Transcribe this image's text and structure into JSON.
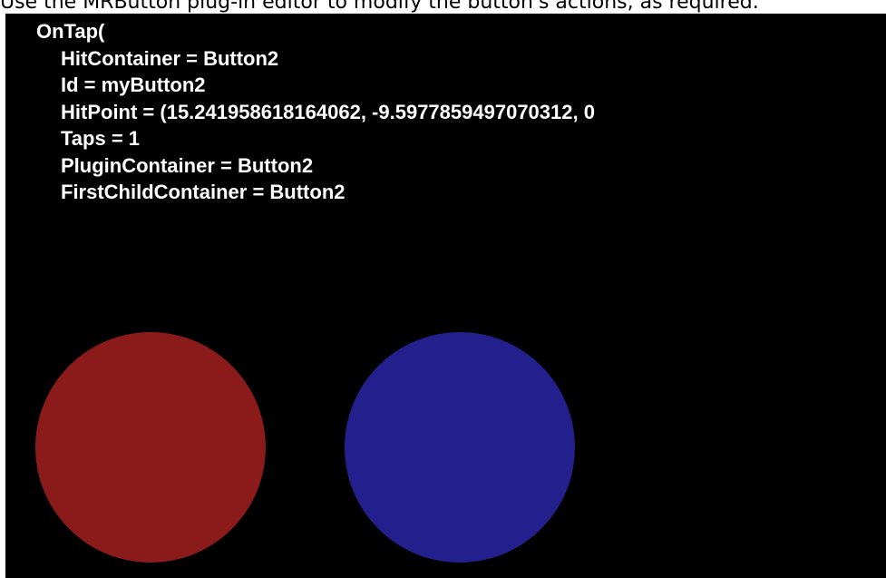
{
  "caption": "Use the MRButton plug-in editor to modify the button's actions, as required.",
  "log": {
    "header": "OnTap(",
    "lines": [
      "HitContainer = Button2",
      "Id = myButton2",
      "HitPoint = (15.241958618164062, -9.5977859497070312, 0",
      "Taps = 1",
      "PluginContainer = Button2",
      "FirstChildContainer = Button2"
    ]
  },
  "buttons": [
    {
      "name": "red-button",
      "color": "#8b1a1a"
    },
    {
      "name": "blue-button",
      "color": "#23208e"
    }
  ],
  "colors": {
    "viewport_bg": "#000000",
    "text": "#ffffff"
  }
}
